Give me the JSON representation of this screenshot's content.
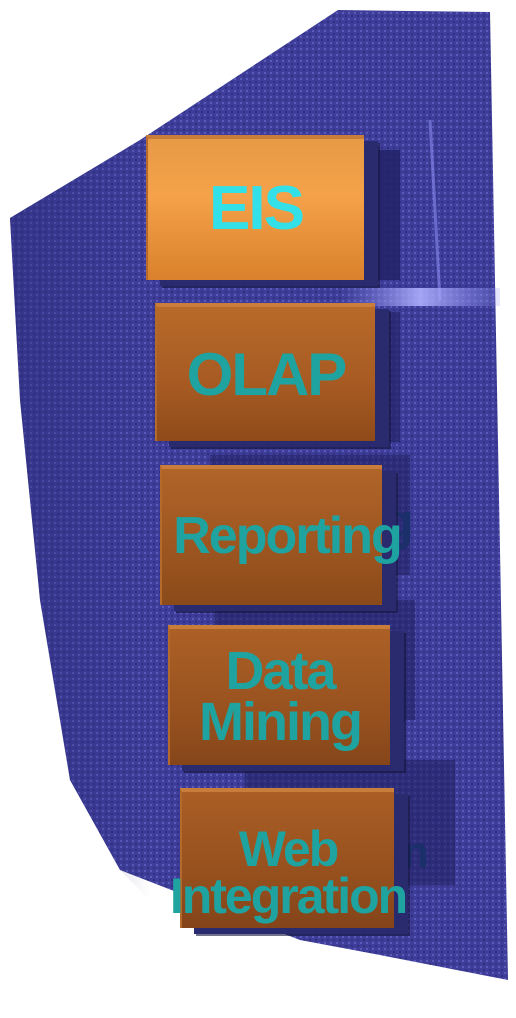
{
  "colors": {
    "panel": "#3c3c96",
    "panel_dark": "#2a2a78",
    "block_top": "#f5a24a",
    "block": "#a65a22",
    "label_highlight": "#33e0e8",
    "label": "#1fa3a0"
  },
  "blocks": [
    {
      "label": "EIS"
    },
    {
      "label": "OLAP"
    },
    {
      "label": "Reporting"
    },
    {
      "label": "Data\nMining"
    },
    {
      "label": "Web\nIntegration"
    }
  ]
}
